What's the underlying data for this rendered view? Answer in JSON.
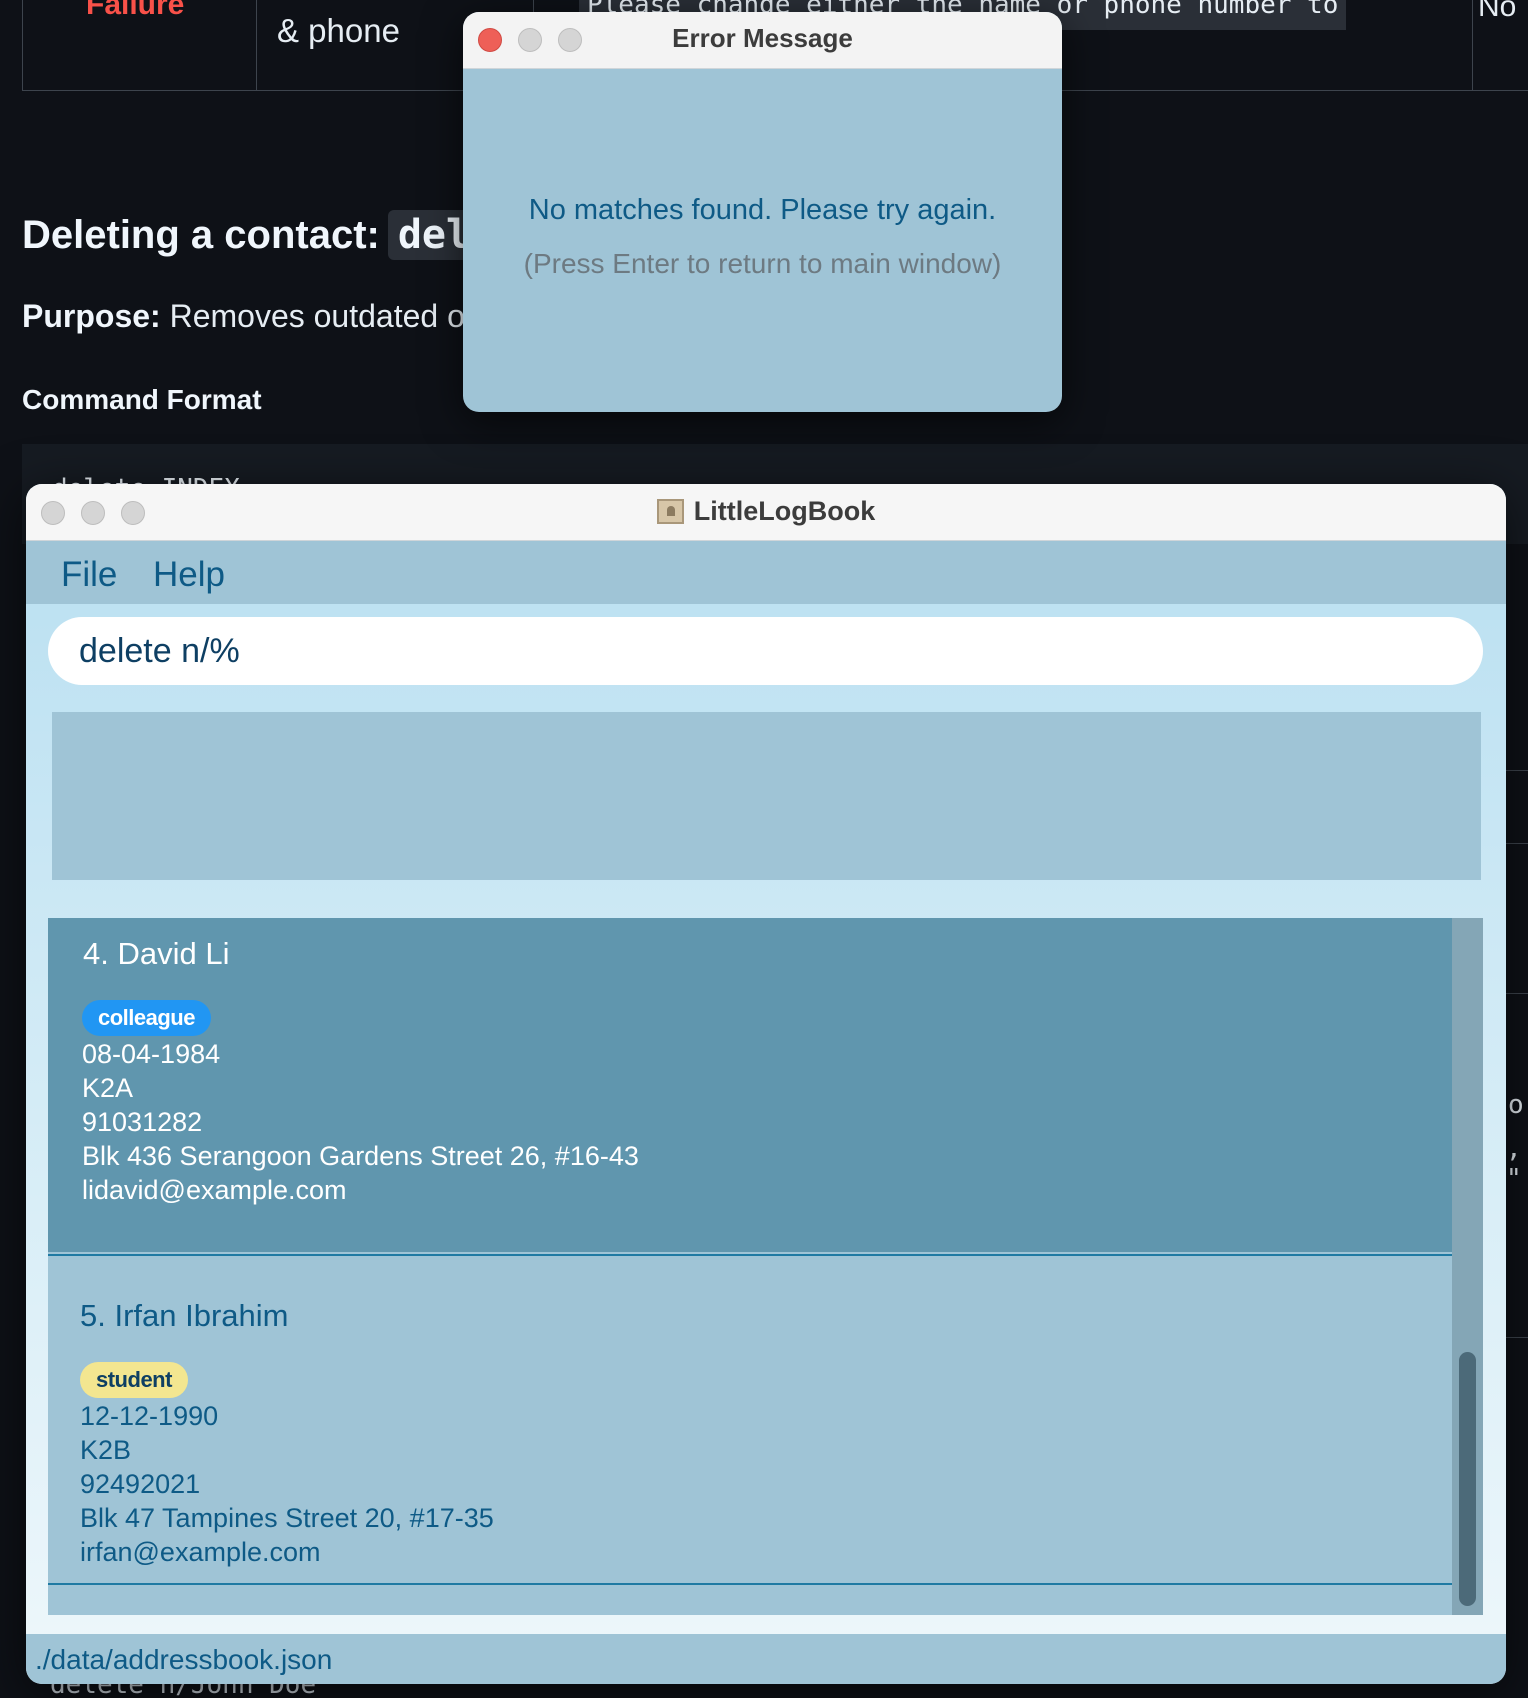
{
  "background_doc": {
    "table_failure": "Failure",
    "table_cell2": "& phone",
    "table_code": "Please change either the name or phone number to",
    "table_last": "No",
    "heading": "Deleting a contact:",
    "heading_code": "dele",
    "purpose_label": "Purpose:",
    "purpose_text": "Removes outdated o",
    "command_format": "Command Format",
    "code_line": "delete INDEX",
    "bottom_code": "delete n/John Doe",
    "right_frag1": "o",
    "right_frag2": ", \""
  },
  "error_dialog": {
    "title": "Error Message",
    "message": "No matches found. Please try again.",
    "hint": "(Press Enter to return to main window)"
  },
  "app": {
    "title": "LittleLogBook",
    "menu": [
      "File",
      "Help"
    ],
    "command_value": "delete n/%",
    "result_text": "",
    "contacts": [
      {
        "name": "4. David Li",
        "tag": "colleague",
        "birthday": "08-04-1984",
        "group": "K2A",
        "phone": "91031282",
        "address": "Blk 436 Serangoon Gardens Street 26, #16-43",
        "email": "lidavid@example.com"
      },
      {
        "name": "5. Irfan Ibrahim",
        "tag": "student",
        "birthday": "12-12-1990",
        "group": "K2B",
        "phone": "92492021",
        "address": "Blk 47 Tampines Street 20, #17-35",
        "email": "irfan@example.com"
      }
    ],
    "status_path": "./data/addressbook.json"
  },
  "colors": {
    "close_red": "#ee5f57",
    "traffic_gray": "#d5d5d5",
    "accent_blue": "#0e5a86",
    "selected_card": "#6096ae",
    "card_bg": "#9fc4d6"
  }
}
